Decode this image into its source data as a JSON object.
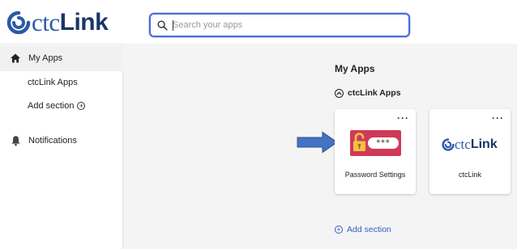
{
  "header": {
    "logo_ctc": "ctc",
    "logo_link": "Link",
    "search_placeholder": "Search your apps"
  },
  "sidebar": {
    "items": [
      {
        "label": "My Apps"
      },
      {
        "label": "ctcLink Apps"
      },
      {
        "label": "Add section"
      },
      {
        "label": "Notifications"
      }
    ]
  },
  "main": {
    "heading": "My Apps",
    "section_title": "ctcLink Apps",
    "cards": [
      {
        "label": "Password Settings",
        "icon_text": "***",
        "menu": "···"
      },
      {
        "label": "ctcLink",
        "logo_ctc": "ctc",
        "logo_link": "Link",
        "menu": "···"
      }
    ],
    "add_section": "Add section"
  },
  "icons": {
    "home": "home-icon",
    "notifications": "bell-icon",
    "search": "search-icon",
    "add": "plus-circle-icon",
    "collapse": "chevron-up-icon",
    "lock": "padlock-icon"
  },
  "colors": {
    "accent": "#2f5fc4",
    "search_border": "#4a6bd6",
    "password_tile": "#cf3a56",
    "logo_blue": "#2a5aa6",
    "logo_navy": "#1b3566",
    "arrow": "#4472c4"
  }
}
